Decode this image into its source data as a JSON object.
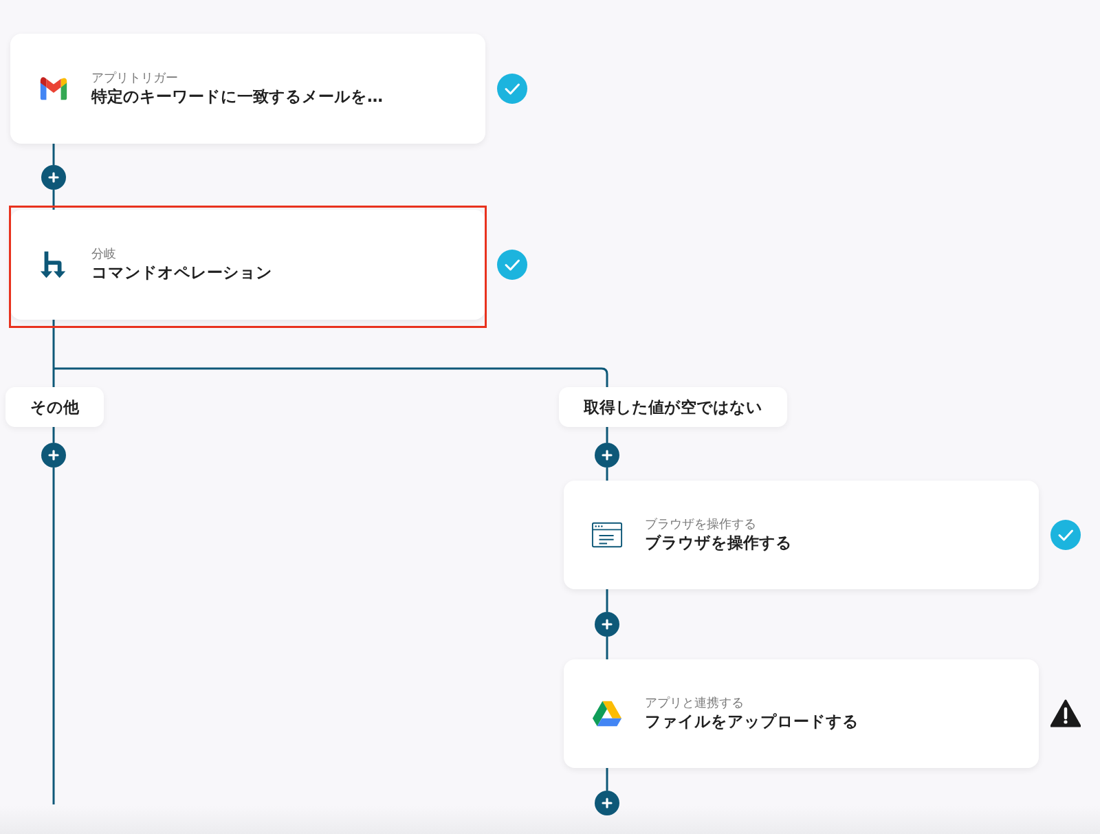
{
  "steps": [
    {
      "kind": "trigger",
      "label": "アプリトリガー",
      "title": "特定のキーワードに一致するメールを…",
      "complete": true,
      "warning": false,
      "highlighted": false
    },
    {
      "kind": "branch",
      "label": "分岐",
      "title": "コマンドオペレーション",
      "complete": true,
      "warning": false,
      "highlighted": true
    }
  ],
  "branches": [
    {
      "label": "その他"
    },
    {
      "label": "取得した値が空ではない",
      "steps": [
        {
          "kind": "browser",
          "label": "ブラウザを操作する",
          "title": "ブラウザを操作する",
          "complete": true,
          "warning": false,
          "highlighted": false
        },
        {
          "kind": "app",
          "label": "アプリと連携する",
          "title": "ファイルをアップロードする",
          "complete": false,
          "warning": true,
          "highlighted": false
        }
      ]
    }
  ]
}
